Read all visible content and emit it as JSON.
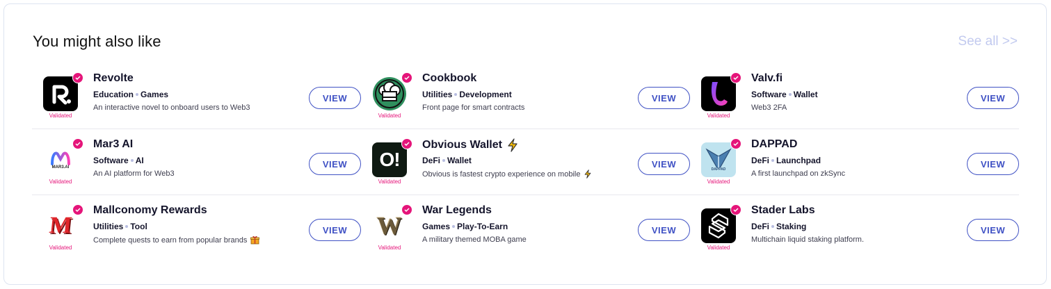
{
  "section": {
    "title": "You might also like",
    "see_all": "See all >>"
  },
  "apps": [
    {
      "name": "Revolte",
      "tags": [
        "Education",
        "Games"
      ],
      "description": "An interactive novel to onboard users to Web3",
      "validated": "Validated",
      "view": "VIEW",
      "icon": "revolte-logo-icon"
    },
    {
      "name": "Cookbook",
      "tags": [
        "Utilities",
        "Development"
      ],
      "description": "Front page for smart contracts",
      "validated": "Validated",
      "view": "VIEW",
      "icon": "chef-hat-icon"
    },
    {
      "name": "Valv.fi",
      "tags": [
        "Software",
        "Wallet"
      ],
      "description": "Web3 2FA",
      "validated": "Validated",
      "view": "VIEW",
      "icon": "valv-logo-icon"
    },
    {
      "name": "Mar3 AI",
      "tags": [
        "Software",
        "AI"
      ],
      "description": "An AI platform for Web3",
      "validated": "Validated",
      "view": "VIEW",
      "icon": "mar3-logo-icon",
      "logo_text": "MAR3.AI"
    },
    {
      "name": "Obvious Wallet",
      "tags": [
        "DeFi",
        "Wallet"
      ],
      "description": "Obvious is fastest crypto experience on mobile",
      "validated": "Validated",
      "view": "VIEW",
      "icon": "obvious-logo-icon",
      "logo_text": "O!"
    },
    {
      "name": "DAPPAD",
      "tags": [
        "DeFi",
        "Launchpad"
      ],
      "description": "A first launchpad on zkSync",
      "validated": "Validated",
      "view": "VIEW",
      "icon": "dappad-logo-icon"
    },
    {
      "name": "Mallconomy Rewards",
      "tags": [
        "Utilities",
        "Tool"
      ],
      "description": "Complete quests to earn from popular brands",
      "validated": "Validated",
      "view": "VIEW",
      "icon": "mallconomy-logo-icon",
      "logo_text": "M"
    },
    {
      "name": "War Legends",
      "tags": [
        "Games",
        "Play-To-Earn"
      ],
      "description": "A military themed MOBA game",
      "validated": "Validated",
      "view": "VIEW",
      "icon": "war-legends-logo-icon",
      "logo_text": "W"
    },
    {
      "name": "Stader Labs",
      "tags": [
        "DeFi",
        "Staking"
      ],
      "description": "Multichain liquid staking platform.",
      "validated": "Validated",
      "view": "VIEW",
      "icon": "stader-logo-icon"
    }
  ],
  "colors": {
    "accent": "#3f51c4",
    "badge": "#e5157a",
    "muted_link": "#c2caef"
  }
}
